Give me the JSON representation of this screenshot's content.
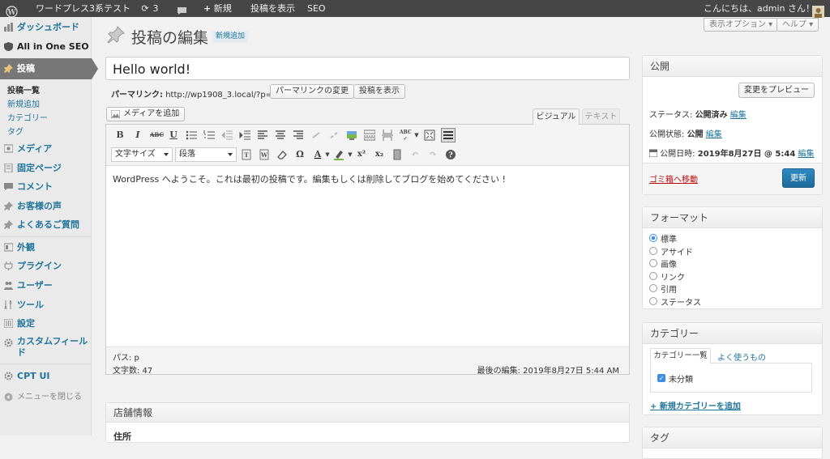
{
  "adminbar": {
    "site_name": "ワードプレス3系テスト",
    "updates_count": "3",
    "new_label": "新規",
    "view_post": "投稿を表示",
    "seo": "SEO",
    "greeting": "こんにちは、admin さん！"
  },
  "sidebar": {
    "dashboard": "ダッシュボード",
    "aioseo": "All in One SEO",
    "posts": "投稿",
    "posts_sub": [
      "投稿一覧",
      "新規追加",
      "カテゴリー",
      "タグ"
    ],
    "media": "メディア",
    "pages": "固定ページ",
    "comments": "コメント",
    "testimonials": "お客様の声",
    "faq": "よくあるご質問",
    "appearance": "外観",
    "plugins": "プラグイン",
    "users": "ユーザー",
    "tools": "ツール",
    "settings": "設定",
    "custom_fields": "カスタムフィールド",
    "cpt_ui": "CPT UI",
    "collapse": "メニューを閉じる"
  },
  "header": {
    "screen_options": "表示オプション ▾",
    "help": "ヘルプ ▾",
    "page_title": "投稿の編集",
    "add_new": "新規追加"
  },
  "editor": {
    "title_value": "Hello world!",
    "permalink_label": "パーマリンク:",
    "permalink_url": "http://wp1908_3.local/?p=1",
    "change_permalink": "パーマリンクの変更",
    "view_post": "投稿を表示",
    "add_media": "メディアを追加",
    "tab_visual": "ビジュアル",
    "tab_text": "テキスト",
    "font_size": "文字サイズ",
    "format": "段落",
    "content": "WordPress へようこそ。これは最初の投稿です。編集もしくは削除してブログを始めてください !",
    "path": "パス: p",
    "word_count": "文字数: 47",
    "last_edited": "最後の編集: 2019年8月27日 5:44 AM"
  },
  "store_box": {
    "title": "店舗情報",
    "field_label": "住所"
  },
  "publish": {
    "title": "公開",
    "preview": "変更をプレビュー",
    "status_label": "ステータス:",
    "status_value": "公開済み",
    "visibility_label": "公開状態:",
    "visibility_value": "公開",
    "date_label": "公開日時:",
    "date_value": "2019年8月27日 @ 5:44",
    "edit": "編集",
    "trash": "ゴミ箱へ移動",
    "update": "更新"
  },
  "format_box": {
    "title": "フォーマット",
    "options": [
      "標準",
      "アサイド",
      "画像",
      "リンク",
      "引用",
      "ステータス"
    ],
    "selected": "標準"
  },
  "category_box": {
    "title": "カテゴリー",
    "tab_all": "カテゴリー一覧",
    "tab_popular": "よく使うもの",
    "items": [
      "未分類"
    ],
    "add_new": "+ 新規カテゴリーを追加"
  },
  "tag_box": {
    "title": "タグ"
  },
  "colors": {
    "link": "#21759b",
    "admin_bar": "#464646",
    "primary_button": "#2a7fb2",
    "trash": "#bc0b0b"
  }
}
